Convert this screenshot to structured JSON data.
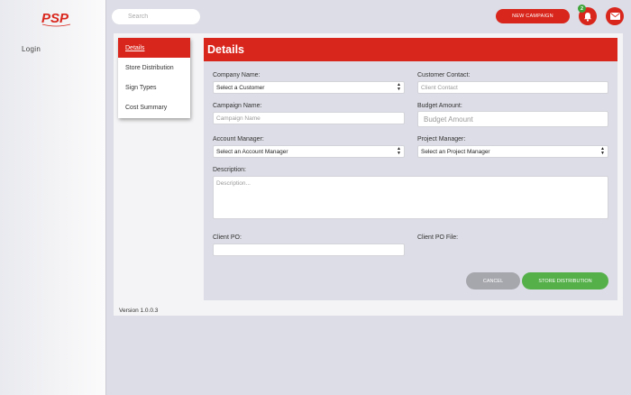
{
  "brand": {
    "logo_text": "PSP",
    "accent": "#d9261c",
    "success": "#55b04a"
  },
  "sidebar": {
    "login_label": "Login"
  },
  "topbar": {
    "search_placeholder": "Search",
    "new_campaign_label": "NEW CAMPAIGN",
    "notification_count": "2",
    "icons": [
      "search-icon",
      "bell-icon",
      "mail-icon"
    ]
  },
  "tabs": [
    {
      "label": "Details",
      "active": true
    },
    {
      "label": "Store Distribution"
    },
    {
      "label": "Sign Types"
    },
    {
      "label": "Cost Summary"
    }
  ],
  "form": {
    "title": "Details",
    "company_label": "Company Name:",
    "company_value": "Select a Customer",
    "contact_label": "Customer Contact:",
    "contact_placeholder": "Client Contact",
    "campaign_label": "Campaign Name:",
    "campaign_placeholder": "Campaign Name",
    "budget_label": "Budget Amount:",
    "budget_placeholder": "Budget Amount",
    "account_label": "Account Manager:",
    "account_value": "Select an Account Manager",
    "project_label": "Project Manager:",
    "project_value": "Select an Project Manager",
    "description_label": "Description:",
    "description_placeholder": "Description...",
    "po_label": "Client PO:",
    "po_file_label": "Client PO File:",
    "cancel_label": "CANCEL",
    "store_label": "STORE DISTRIBUTION"
  },
  "footer": {
    "version": "Version 1.0.0.3"
  }
}
